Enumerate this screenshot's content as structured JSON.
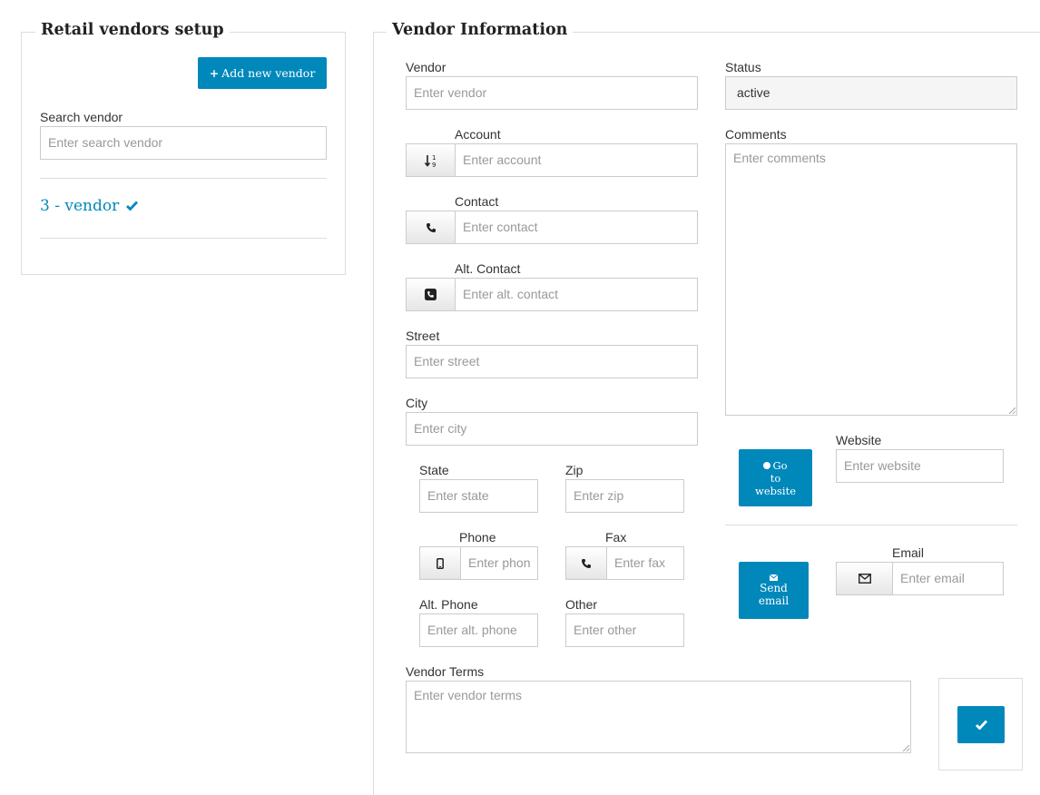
{
  "left_panel": {
    "title": "Retail vendors setup",
    "add_button_label": "Add new vendor",
    "search_label": "Search vendor",
    "search_placeholder": "Enter search vendor",
    "vendors": [
      {
        "label": "3 - vendor",
        "verified": true
      }
    ]
  },
  "right_panel": {
    "title": "Vendor Information",
    "vendor": {
      "label": "Vendor",
      "placeholder": "Enter vendor"
    },
    "account": {
      "label": "Account",
      "placeholder": "Enter account",
      "icon": "sort-numeric-icon"
    },
    "contact": {
      "label": "Contact",
      "placeholder": "Enter contact",
      "icon": "phone-icon"
    },
    "alt_contact": {
      "label": "Alt. Contact",
      "placeholder": "Enter alt. contact",
      "icon": "phone-square-icon"
    },
    "street": {
      "label": "Street",
      "placeholder": "Enter street"
    },
    "city": {
      "label": "City",
      "placeholder": "Enter city"
    },
    "state": {
      "label": "State",
      "placeholder": "Enter state"
    },
    "zip": {
      "label": "Zip",
      "placeholder": "Enter zip"
    },
    "phone": {
      "label": "Phone",
      "placeholder": "Enter phon",
      "icon": "mobile-icon"
    },
    "fax": {
      "label": "Fax",
      "placeholder": "Enter fax",
      "icon": "phone-icon"
    },
    "alt_phone": {
      "label": "Alt. Phone",
      "placeholder": "Enter alt. phone"
    },
    "other": {
      "label": "Other",
      "placeholder": "Enter other"
    },
    "status": {
      "label": "Status",
      "value": "active"
    },
    "comments": {
      "label": "Comments",
      "placeholder": "Enter comments"
    },
    "website": {
      "label": "Website",
      "placeholder": "Enter website",
      "button_lines": [
        "Go",
        "to",
        "website"
      ],
      "icon": "globe-icon"
    },
    "email": {
      "label": "Email",
      "placeholder": "Enter email",
      "button_lines": [
        "Send",
        "email"
      ],
      "icon": "envelope-icon"
    },
    "vendor_terms": {
      "label": "Vendor Terms",
      "placeholder": "Enter vendor terms"
    },
    "save_icon": "check-icon"
  },
  "colors": {
    "accent": "#0088bb",
    "border": "#cccccc",
    "divider": "#dddddd"
  }
}
